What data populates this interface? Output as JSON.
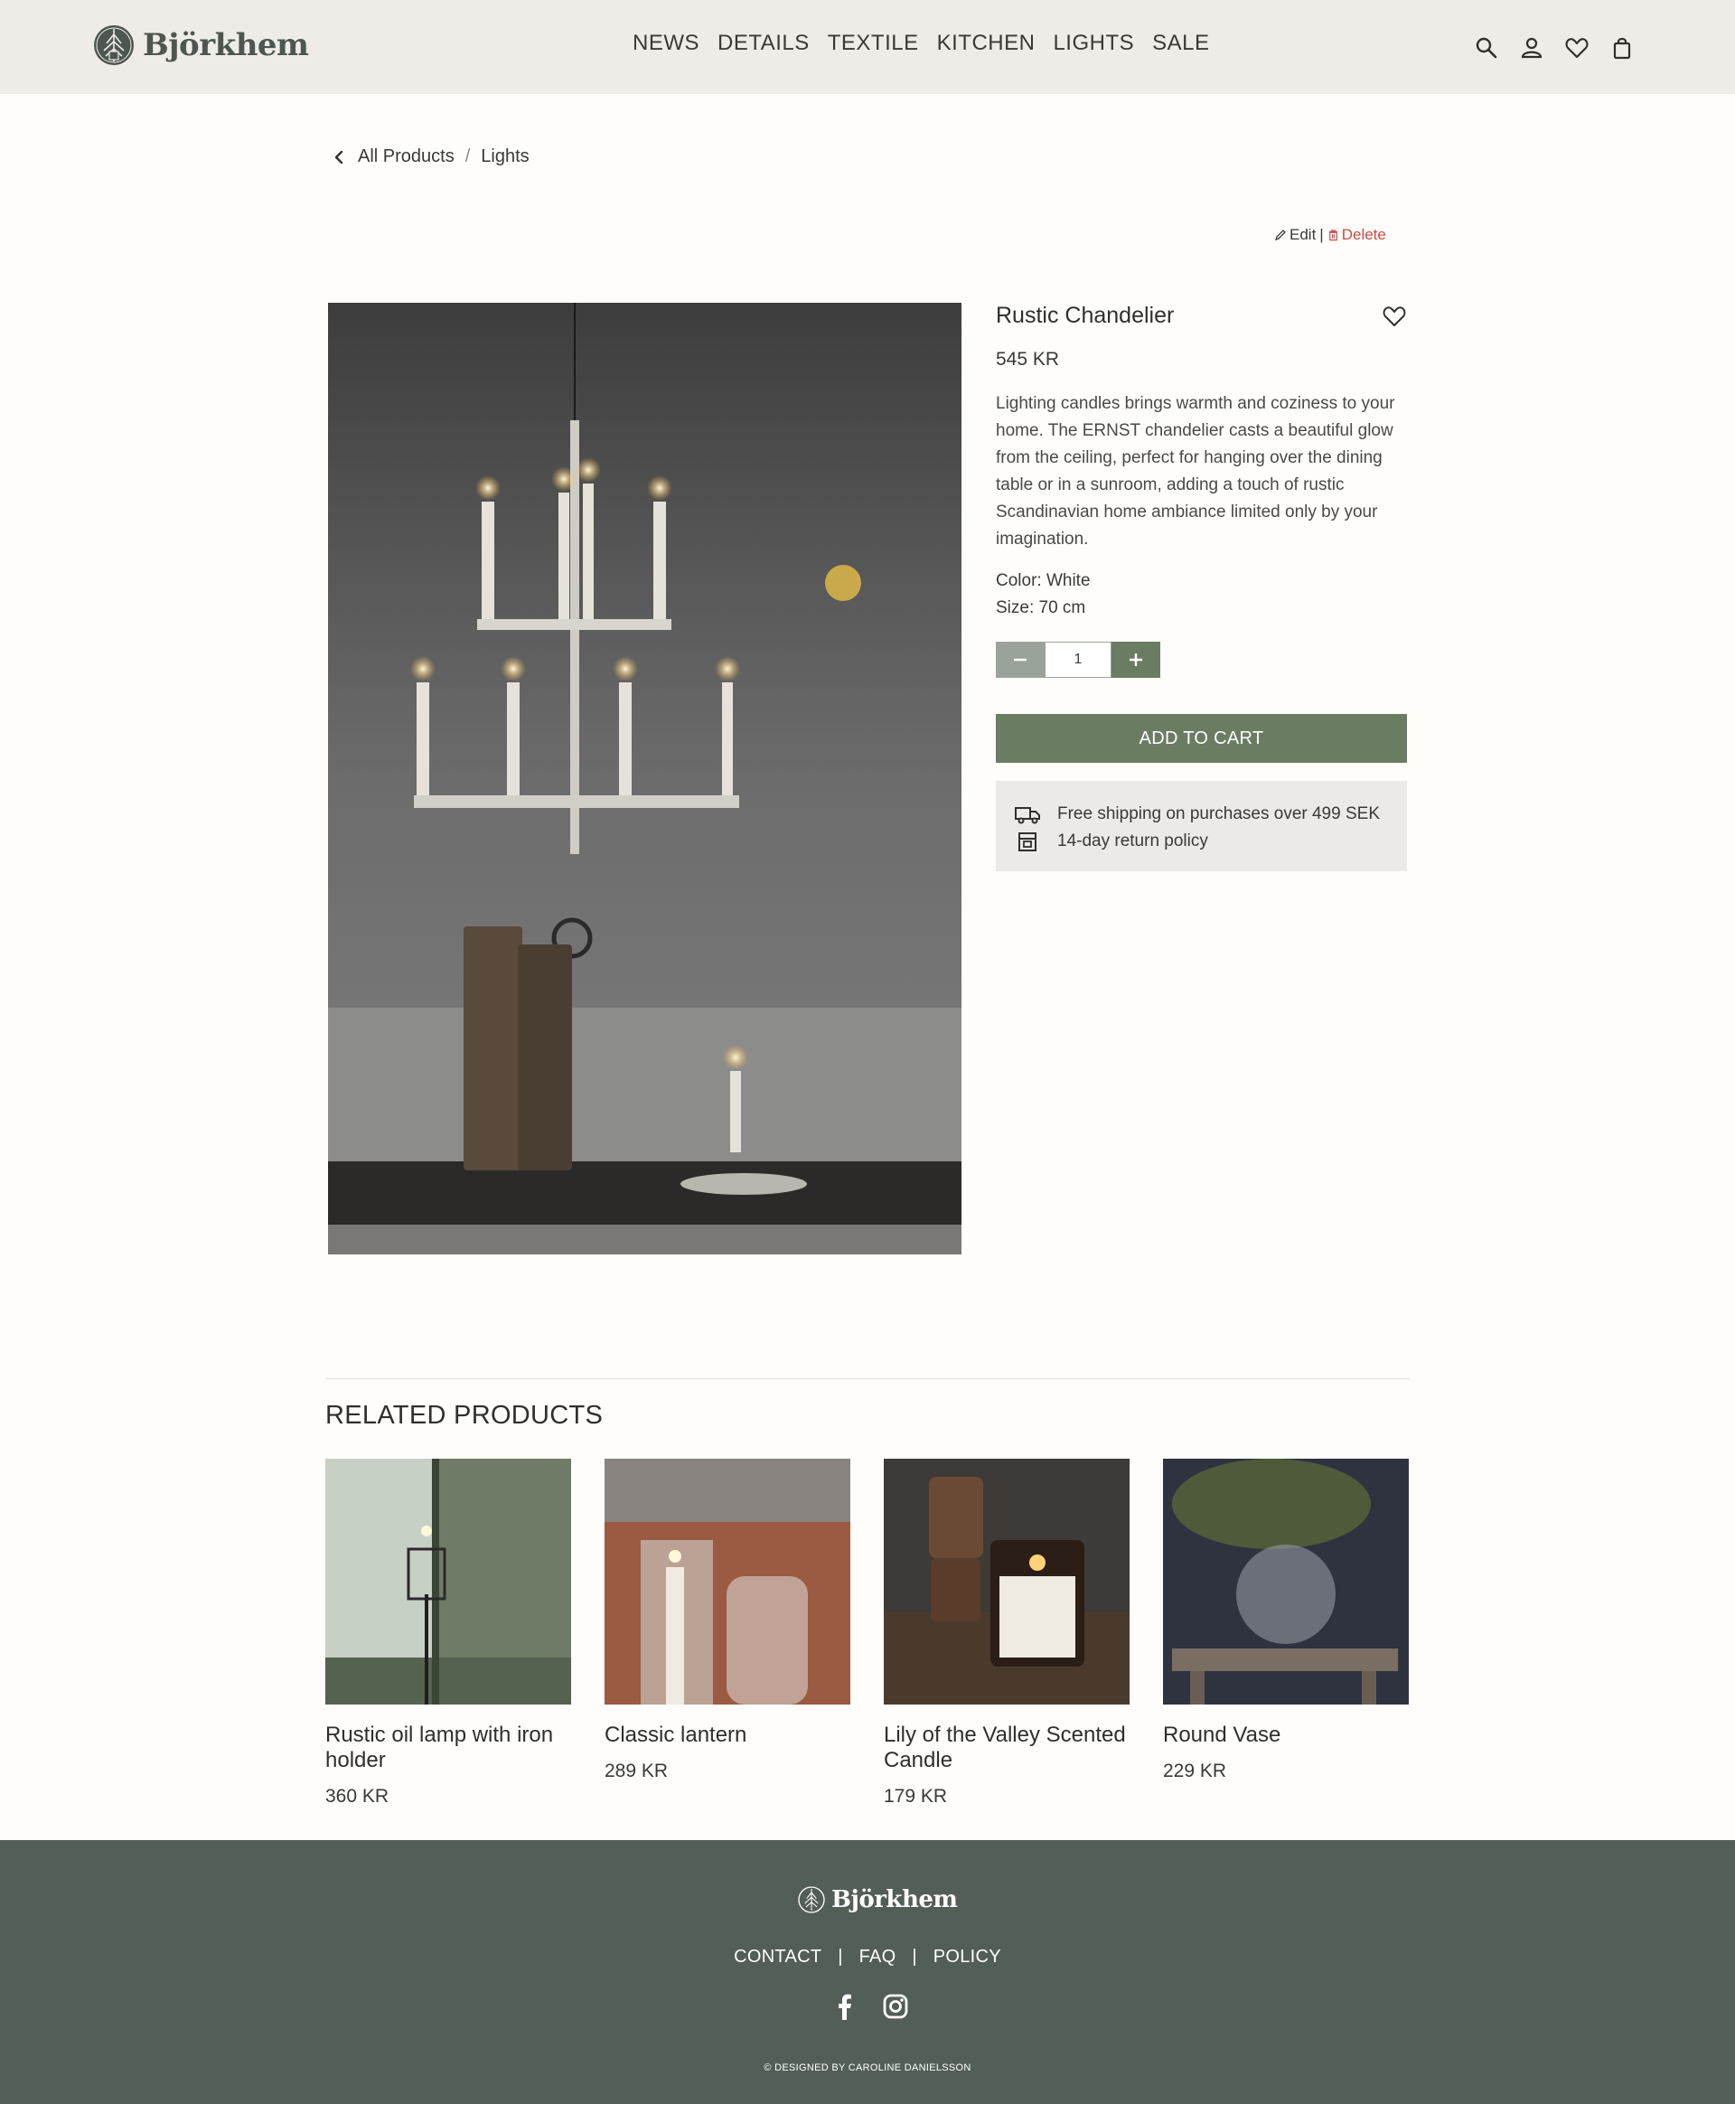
{
  "brand": {
    "name": "Björkhem"
  },
  "nav": {
    "items": [
      "NEWS",
      "DETAILS",
      "TEXTILE",
      "KITCHEN",
      "LIGHTS",
      "SALE"
    ]
  },
  "header_icons": [
    "search-icon",
    "user-icon",
    "heart-icon",
    "bag-icon"
  ],
  "breadcrumb": {
    "root": "All Products",
    "separator": "/",
    "current": "Lights"
  },
  "admin": {
    "edit": "Edit",
    "divider": "|",
    "delete": "Delete"
  },
  "product": {
    "title": "Rustic Chandelier",
    "price": "545 KR",
    "description": "Lighting candles brings warmth and coziness to your home. The ERNST chandelier casts a beautiful glow from the ceiling, perfect for hanging over the dining table or in a sunroom, adding a touch of rustic Scandinavian home ambiance limited only by your imagination.",
    "color": "Color: White",
    "size": "Size: 70 cm",
    "quantity": "1",
    "add_to_cart": "ADD TO CART",
    "perks": [
      "Free shipping on purchases over 499 SEK",
      "14-day return policy"
    ]
  },
  "related": {
    "title": "RELATED PRODUCTS",
    "items": [
      {
        "name": "Rustic oil lamp with iron holder",
        "price": "360 KR"
      },
      {
        "name": "Classic lantern",
        "price": "289 KR"
      },
      {
        "name": "Lily of the Valley Scented Candle",
        "price": "179 KR"
      },
      {
        "name": "Round Vase",
        "price": "229 KR"
      }
    ]
  },
  "footer": {
    "brand": "Björkhem",
    "links": [
      "CONTACT",
      "FAQ",
      "POLICY"
    ],
    "link_separator": "|",
    "credit": "© DESIGNED BY CAROLINE DANIELSSON"
  },
  "colors": {
    "accent_green": "#6a7d63",
    "footer_bg": "#535e56",
    "header_bg": "#eeece7",
    "delete_red": "#c94a4a"
  }
}
